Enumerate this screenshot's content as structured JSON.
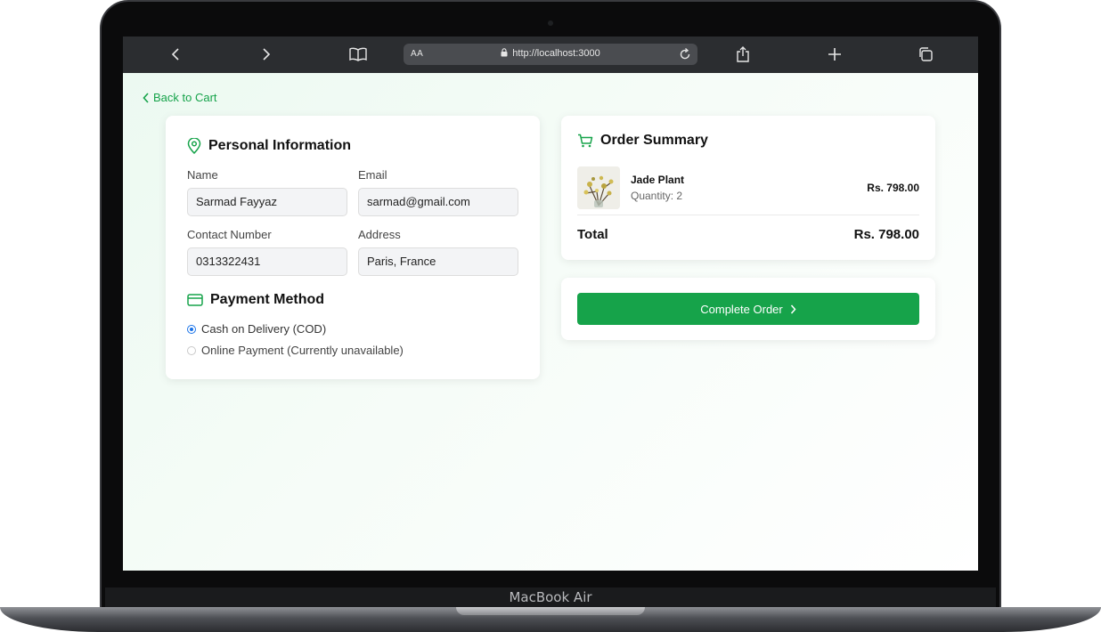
{
  "device": {
    "brand_label": "MacBook Air"
  },
  "browser": {
    "url": "http://localhost:3000",
    "reader_label": "AA"
  },
  "page": {
    "back_link": "Back to Cart",
    "personal": {
      "title": "Personal Information",
      "name_label": "Name",
      "name_value": "Sarmad Fayyaz",
      "email_label": "Email",
      "email_value": "sarmad@gmail.com",
      "contact_label": "Contact Number",
      "contact_value": "0313322431",
      "address_label": "Address",
      "address_value": "Paris, France"
    },
    "payment": {
      "title": "Payment Method",
      "options": [
        {
          "label": "Cash on Delivery (COD)",
          "checked": true
        },
        {
          "label": "Online Payment (Currently unavailable)",
          "checked": false
        }
      ]
    },
    "summary": {
      "title": "Order Summary",
      "item_name": "Jade Plant",
      "item_quantity": "Quantity: 2",
      "item_price": "Rs. 798.00",
      "total_label": "Total",
      "total_value": "Rs. 798.00"
    },
    "complete_button": "Complete Order"
  },
  "colors": {
    "accent": "#16a34a",
    "radio_checked": "#1a73e8",
    "page_tint": "#ecf9f1"
  }
}
